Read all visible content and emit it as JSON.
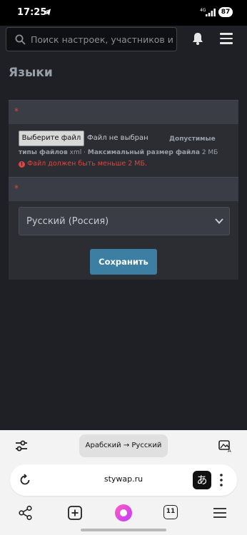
{
  "status_bar": {
    "time": "17:25",
    "network": "4G",
    "battery": "87"
  },
  "header": {
    "search_placeholder": "Поиск настроек, участников и т.д."
  },
  "page": {
    "title": "Языки"
  },
  "form": {
    "required_mark": "*",
    "file_button": "Выберите файл",
    "file_status": "Файл не выбран",
    "allowed_label_1": "Допустимые",
    "allowed_label_2": "типы файлов",
    "allowed_types": "xml",
    "separator": "·",
    "max_size_label": "Максимальный размер файла",
    "max_size_value": "2 МБ",
    "error_text": "Файл должен быть меньше 2 МБ.",
    "language_select": "Русский (Россия)",
    "save_button": "Сохранить"
  },
  "browser": {
    "translate_pill": "Арабский → Русский",
    "url": "stywap.ru",
    "translate_icon_glyph": "あ",
    "tabs_count": "11"
  },
  "colors": {
    "accent": "#3d7fa3",
    "error": "#e0443c",
    "background": "#1f2026",
    "panel": "#2b2d33"
  }
}
